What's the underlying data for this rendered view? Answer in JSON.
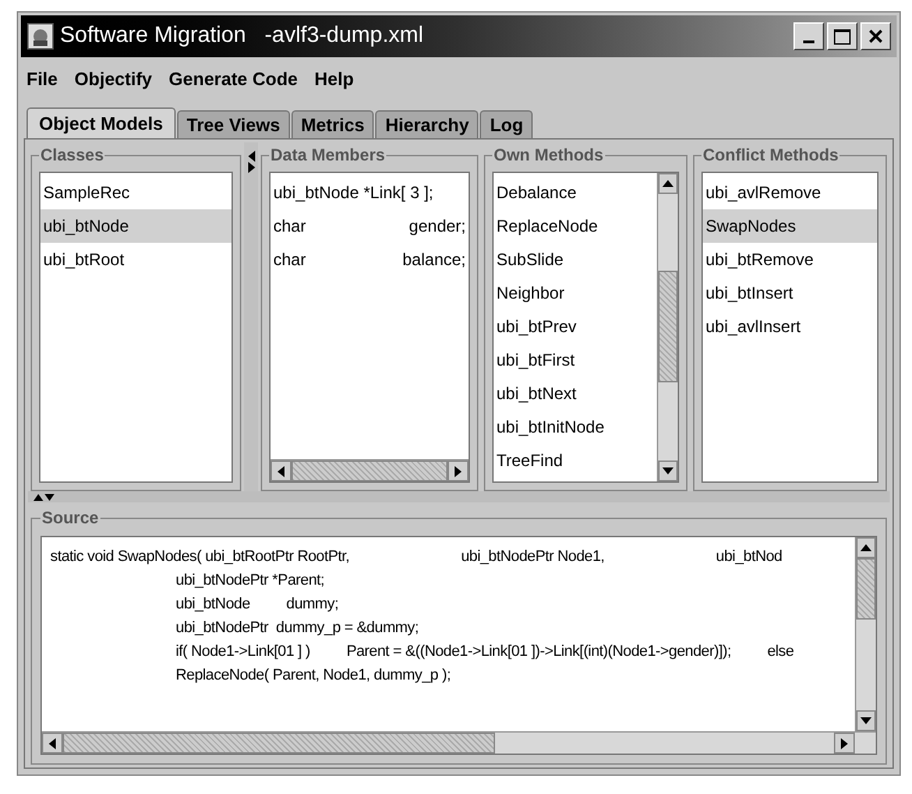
{
  "window": {
    "title": "Software Migration   -avlf3-dump.xml"
  },
  "menu": [
    "File",
    "Objectify",
    "Generate Code",
    "Help"
  ],
  "tabs": [
    {
      "label": "Object Models",
      "selected": true
    },
    {
      "label": "Tree Views",
      "selected": false
    },
    {
      "label": "Metrics",
      "selected": false
    },
    {
      "label": "Hierarchy",
      "selected": false
    },
    {
      "label": "Log",
      "selected": false
    }
  ],
  "classes": {
    "title": "Classes",
    "items": [
      {
        "label": "SampleRec",
        "selected": false
      },
      {
        "label": "ubi_btNode",
        "selected": true
      },
      {
        "label": "ubi_btRoot",
        "selected": false
      }
    ]
  },
  "data_members": {
    "title": "Data Members",
    "items": [
      {
        "parts": [
          "ubi_btNode *Link[ 3 ];"
        ]
      },
      {
        "parts": [
          "char",
          "gender;"
        ]
      },
      {
        "parts": [
          "char",
          "balance;"
        ]
      }
    ]
  },
  "own_methods": {
    "title": "Own Methods",
    "items": [
      {
        "label": "Debalance",
        "selected": false
      },
      {
        "label": "ReplaceNode",
        "selected": false
      },
      {
        "label": "SubSlide",
        "selected": false
      },
      {
        "label": "Neighbor",
        "selected": false
      },
      {
        "label": "ubi_btPrev",
        "selected": false
      },
      {
        "label": "ubi_btFirst",
        "selected": false
      },
      {
        "label": "ubi_btNext",
        "selected": false
      },
      {
        "label": "ubi_btInitNode",
        "selected": false
      },
      {
        "label": "TreeFind",
        "selected": false
      }
    ]
  },
  "conflict_methods": {
    "title": "Conflict Methods",
    "items": [
      {
        "label": "ubi_avlRemove",
        "selected": false
      },
      {
        "label": "SwapNodes",
        "selected": true
      },
      {
        "label": "ubi_btRemove",
        "selected": false
      },
      {
        "label": "ubi_btInsert",
        "selected": false
      },
      {
        "label": "ubi_avlInsert",
        "selected": false
      }
    ]
  },
  "source": {
    "title": "Source",
    "lines": [
      {
        "kind": "head",
        "parts": [
          "static void SwapNodes( ubi_btRootPtr RootPtr,",
          "ubi_btNodePtr Node1,",
          "ubi_btNod"
        ]
      },
      {
        "kind": "body",
        "parts": [
          "ubi_btNodePtr *Parent;"
        ]
      },
      {
        "kind": "body",
        "parts": [
          "ubi_btNode",
          "dummy;"
        ]
      },
      {
        "kind": "body",
        "parts": [
          "ubi_btNodePtr  dummy_p = &dummy;"
        ]
      },
      {
        "kind": "body",
        "parts": [
          "if( Node1->Link[01 ] )",
          "Parent = &((Node1->Link[01 ])->Link[(int)(Node1->gender)]);",
          "else"
        ]
      },
      {
        "kind": "body",
        "parts": [
          "ReplaceNode( Parent, Node1, dummy_p );"
        ]
      }
    ]
  }
}
